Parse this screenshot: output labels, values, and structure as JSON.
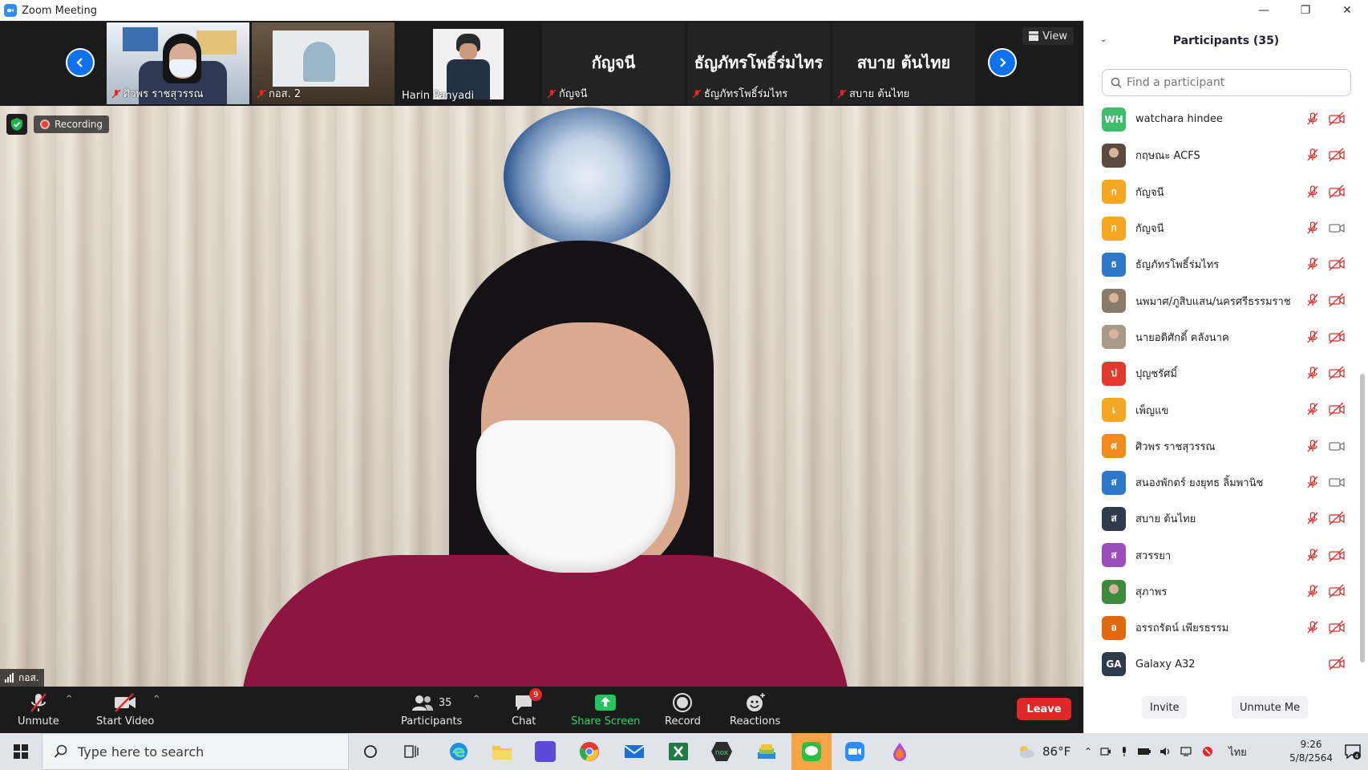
{
  "window": {
    "title": "Zoom Meeting"
  },
  "strip": {
    "view_label": "View",
    "thumbnails": [
      {
        "name": "ศิวพร ราชสุวรรณ",
        "kind": "video",
        "muted": true
      },
      {
        "name": "กอส. 2",
        "kind": "video",
        "muted": true
      },
      {
        "name": "Harin Panyadi",
        "kind": "video",
        "muted": false
      },
      {
        "name": "กัญจนี",
        "kind": "name",
        "display": "กัญจนี",
        "muted": true
      },
      {
        "name": "ธัญภัทรโพธิ์ร่มไทร",
        "kind": "name",
        "display": "ธัญภัทรโพธิ์ร่มไทร",
        "muted": true
      },
      {
        "name": "สบาย ต้นไทย",
        "kind": "name",
        "display": "สบาย ต้นไทย",
        "muted": true
      }
    ]
  },
  "main": {
    "recording_label": "Recording",
    "speaker_label": "กอส."
  },
  "controls": {
    "unmute": "Unmute",
    "start_video": "Start Video",
    "participants": "Participants",
    "participants_count": "35",
    "chat": "Chat",
    "chat_badge": "9",
    "share_screen": "Share Screen",
    "record": "Record",
    "reactions": "Reactions",
    "leave": "Leave"
  },
  "panel": {
    "title": "Participants (35)",
    "search_placeholder": "Find a participant",
    "invite": "Invite",
    "unmute_me": "Unmute Me",
    "participants": [
      {
        "name": "watchara hindee",
        "avatar_text": "WH",
        "avatar_color": "#3ebd6b",
        "mic": "muted",
        "cam": "off"
      },
      {
        "name": "กฤษณะ ACFS",
        "avatar_text": "",
        "avatar_color": "#5a4a3f",
        "mic": "muted",
        "cam": "off",
        "photo": true
      },
      {
        "name": "กัญจนี",
        "avatar_text": "ก",
        "avatar_color": "#f5a623",
        "mic": "muted",
        "cam": "off"
      },
      {
        "name": "กัญจนี",
        "avatar_text": "ก",
        "avatar_color": "#f5a623",
        "mic": "muted",
        "cam": "on"
      },
      {
        "name": "ธัญภัทรโพธิ์ร่มไทร",
        "avatar_text": "ธ",
        "avatar_color": "#2d78c9",
        "mic": "muted",
        "cam": "off"
      },
      {
        "name": "นพมาศ/ภูสิบแสน/นครศรีธรรมราช",
        "avatar_text": "",
        "avatar_color": "#8a7a6a",
        "mic": "muted",
        "cam": "off",
        "photo": true
      },
      {
        "name": "นายอดิศักดิ์ คลังนาค",
        "avatar_text": "",
        "avatar_color": "#a89a88",
        "mic": "muted",
        "cam": "off",
        "photo": true
      },
      {
        "name": "ปุญชรัศมิ์",
        "avatar_text": "ป",
        "avatar_color": "#e03b2e",
        "mic": "muted",
        "cam": "off"
      },
      {
        "name": "เพ็ญแข",
        "avatar_text": "เ",
        "avatar_color": "#f5a623",
        "mic": "muted",
        "cam": "off"
      },
      {
        "name": "ศิวพร ราชสุวรรณ",
        "avatar_text": "ศ",
        "avatar_color": "#f08a1c",
        "mic": "muted",
        "cam": "on"
      },
      {
        "name": "สนองพักตร์ ยงยุทธ ลิ้มพานิช",
        "avatar_text": "ส",
        "avatar_color": "#2d78c9",
        "mic": "muted",
        "cam": "on"
      },
      {
        "name": "สบาย ต้นไทย",
        "avatar_text": "ส",
        "avatar_color": "#2f3a4a",
        "mic": "muted",
        "cam": "off"
      },
      {
        "name": "สวรรยา",
        "avatar_text": "ส",
        "avatar_color": "#9b4dbb",
        "mic": "muted",
        "cam": "off"
      },
      {
        "name": "สุภาพร",
        "avatar_text": "",
        "avatar_color": "#3d8a3e",
        "mic": "muted",
        "cam": "off",
        "photo": true
      },
      {
        "name": "อรรถรัตน์ เพียรธรรม",
        "avatar_text": "อ",
        "avatar_color": "#e06a10",
        "mic": "muted",
        "cam": "off"
      },
      {
        "name": "Galaxy A32",
        "avatar_text": "GA",
        "avatar_color": "#2f3a4a",
        "mic": "none",
        "cam": "off"
      }
    ]
  },
  "taskbar": {
    "search_placeholder": "Type here to search",
    "temperature": "86°F",
    "language": "ไทย",
    "time": "9:26",
    "date": "5/8/2564",
    "notification_count": "4"
  },
  "colors": {
    "accent": "#0e72ed",
    "leave": "#e02828",
    "share": "#22c55e"
  }
}
